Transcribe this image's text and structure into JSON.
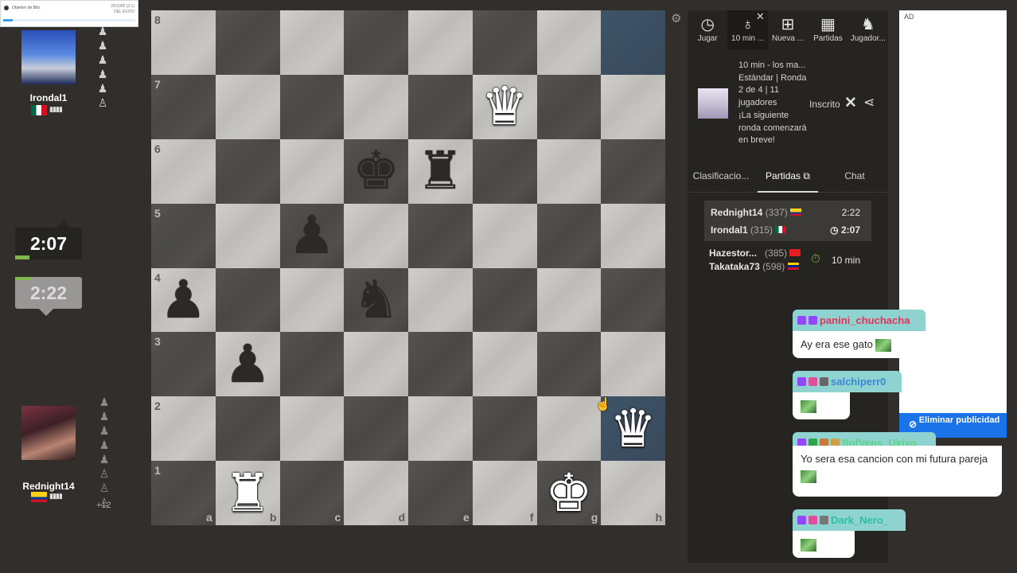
{
  "goal": {
    "title": "Objetivo de Bits",
    "value_top": "25/1000 (3.1)",
    "value_bottom": "DEL EXITO",
    "progress": 0.07
  },
  "top_player": {
    "name": "Irondal1",
    "flag": "mx",
    "clock": "2:07",
    "captured": [
      "♟",
      "♟",
      "♟",
      "♟",
      "♟",
      "♙"
    ]
  },
  "bottom_player": {
    "name": "Rednight14",
    "flag": "co",
    "clock": "2:22",
    "captured": [
      "♟",
      "♟",
      "♟",
      "♟",
      "♟",
      "♙",
      "♙",
      "♙"
    ],
    "material": "+12"
  },
  "board": {
    "ranks": [
      "8",
      "7",
      "6",
      "5",
      "4",
      "3",
      "2",
      "1"
    ],
    "files": [
      "a",
      "b",
      "c",
      "d",
      "e",
      "f",
      "g",
      "h"
    ],
    "highlighted": [
      "h8",
      "h2"
    ],
    "pieces": {
      "f7": {
        "glyph": "♛",
        "color": "w"
      },
      "d6": {
        "glyph": "♚",
        "color": "b"
      },
      "e6": {
        "glyph": "♜",
        "color": "b"
      },
      "c5": {
        "glyph": "♟",
        "color": "b"
      },
      "a4": {
        "glyph": "♟",
        "color": "b"
      },
      "d4": {
        "glyph": "♞",
        "color": "b"
      },
      "b3": {
        "glyph": "♟",
        "color": "b"
      },
      "h2": {
        "glyph": "♛",
        "color": "w"
      },
      "b1": {
        "glyph": "♜",
        "color": "w"
      },
      "g1": {
        "glyph": "♚",
        "color": "w"
      }
    }
  },
  "nav": [
    {
      "label": "Jugar",
      "icon": "stopwatch-icon",
      "glyph": "◷"
    },
    {
      "label": "10 min ...",
      "icon": "medal-icon",
      "glyph": "♁"
    },
    {
      "label": "Nueva ...",
      "icon": "plus-icon",
      "glyph": "⊞"
    },
    {
      "label": "Partidas",
      "icon": "board-icon",
      "glyph": "▦"
    },
    {
      "label": "Jugador...",
      "icon": "players-icon",
      "glyph": "♞"
    }
  ],
  "tournament": {
    "lines": [
      "10 min - los ma...",
      "Estándar | Ronda",
      "2 de 4 | 11",
      "jugadores",
      "¡La siguiente",
      "ronda comenzará",
      "en breve!"
    ],
    "status": "Inscrito"
  },
  "tabs": [
    "Clasificacio...",
    "Partidas",
    "Chat"
  ],
  "games": [
    {
      "white": "Rednight14",
      "white_rating": "(337)",
      "white_time": "2:22",
      "black": "Irondal1",
      "black_rating": "(315)",
      "black_time": "2:07"
    },
    {
      "white": "Hazestor...",
      "white_rating": "(385)",
      "black": "Takataka73",
      "black_rating": "(598)",
      "time_control": "10 min"
    }
  ],
  "chat": [
    {
      "user": "panini_chuchacha",
      "color": "#e0325a",
      "text": "Ay era ese gato",
      "emote": true
    },
    {
      "user": "salchiperr0",
      "color": "#3b86d8",
      "text": "",
      "emote": true
    },
    {
      "user": "SofVens_Ukiyo",
      "color": "#5cd48a",
      "text": "Yo sera esa cancion con mi futura pareja",
      "emote": true
    },
    {
      "user": "Dark_Nero_",
      "color": "#2bbfa9",
      "text": "",
      "emote": true
    }
  ],
  "ad": {
    "label": "AD",
    "button": "Eliminar publicidad"
  },
  "colors": {
    "accent": "#81b64c",
    "panel": "#262421",
    "background": "#312e2b"
  }
}
